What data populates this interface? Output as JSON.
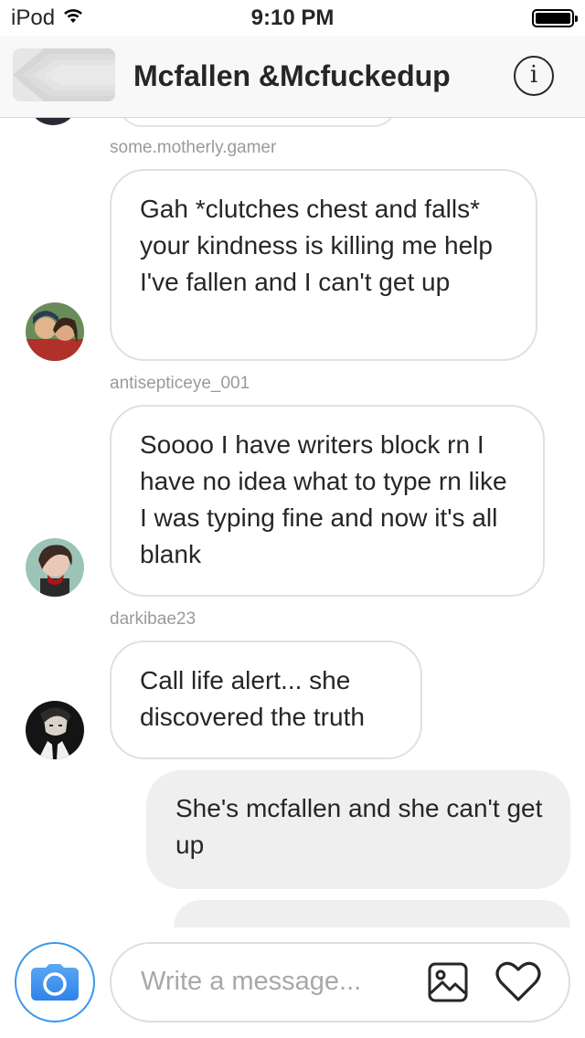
{
  "status_bar": {
    "device": "iPod",
    "time": "9:10 PM"
  },
  "header": {
    "title": "Mcfallen &Mcfuckedup"
  },
  "messages": [
    {
      "username": "some.motherly.gamer",
      "text": "Gah *clutches chest and falls* your kindness is killing me help I've fallen and I can't get up"
    },
    {
      "username": "antisepticeye_001",
      "text": "Soooo I have writers block rn I have no idea what to type rn like I was typing fine and now it's all blank"
    },
    {
      "username": "darkibae23",
      "text": "Call life alert... she discovered the truth"
    },
    {
      "text": "She's mcfallen and she can't get up"
    }
  ],
  "composer": {
    "placeholder": "Write a message..."
  },
  "colors": {
    "accent": "#3897f0",
    "bubble_outgoing": "#efefef",
    "bubble_border": "#e0e0e0"
  },
  "icons": [
    "wifi-icon",
    "battery-icon",
    "back-arrow-icon",
    "info-icon",
    "camera-icon",
    "gallery-icon",
    "heart-icon"
  ]
}
